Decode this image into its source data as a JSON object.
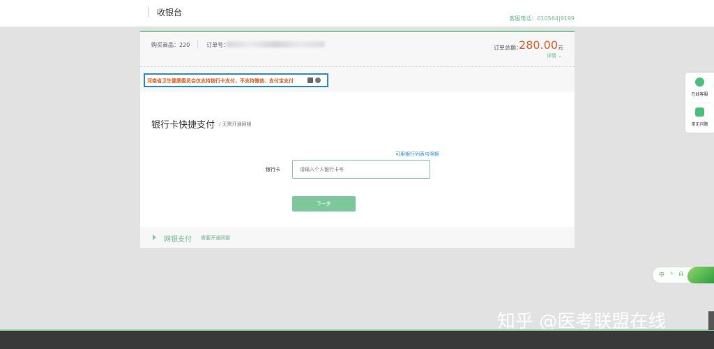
{
  "header": {
    "title": "收银台",
    "hotline": "客服电话：010564|9199"
  },
  "order": {
    "goods_label": "购买商品：220",
    "order_no_label": "订单号：",
    "total_label": "订单总额：",
    "amount": "280.00",
    "currency": "元",
    "detail_label": "详情 ⌄"
  },
  "notice": {
    "text": "河南省卫生健康委员会仅支持银行卡支付，不支持微信、支付宝支付"
  },
  "section": {
    "title": "银行卡快捷支付",
    "subtitle": "/ 无需开通网银"
  },
  "form": {
    "bank_list_link": "可用银行列表与限额",
    "card_label": "银行卡",
    "card_placeholder": "请输入个人银行卡号",
    "next_label": "下一步"
  },
  "netbank": {
    "name": "网银支付",
    "hint": "需要开通网银"
  },
  "side": {
    "service_label": "在线客服",
    "faq_label": "常见问题"
  },
  "lang_widget": {
    "lang": "中",
    "options": "ᐞ ᕱ"
  },
  "watermark": "知乎 @医考联盟在线",
  "colors": {
    "accent_green": "#7ccc98",
    "amount_orange": "#e35b23",
    "notice_border": "#2b8fd8"
  }
}
